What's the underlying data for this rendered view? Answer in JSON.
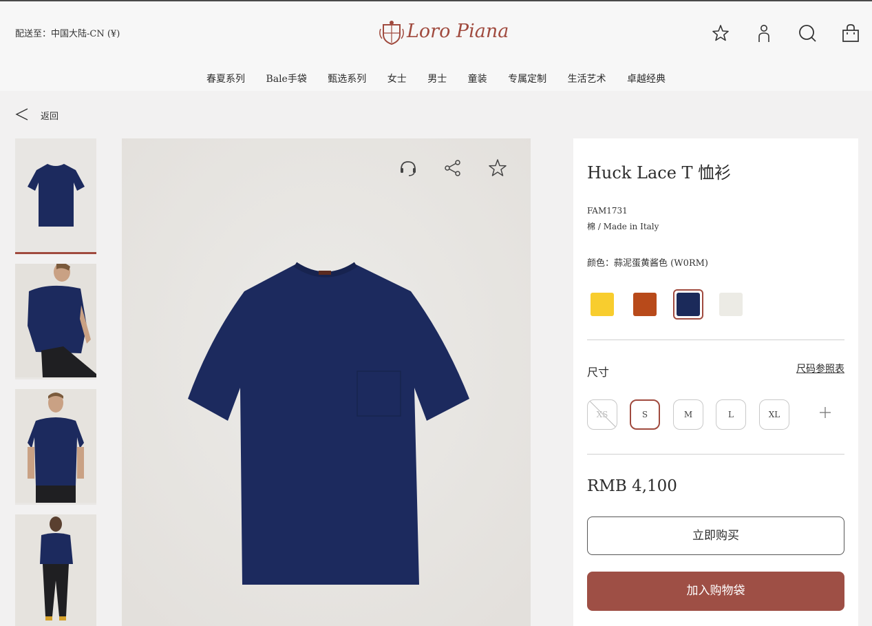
{
  "header": {
    "ship_to": "配送至：中国大陆-CN (¥)",
    "logo_text": "Loro Piana",
    "icons": [
      "star-icon",
      "user-icon",
      "search-icon",
      "bag-icon"
    ]
  },
  "nav": {
    "items": [
      "春夏系列",
      "Bale手袋",
      "甄选系列",
      "女士",
      "男士",
      "童装",
      "专属定制",
      "生活艺术",
      "卓越经典"
    ]
  },
  "back": {
    "label": "返回"
  },
  "product": {
    "title": "Huck Lace T 恤衫",
    "sku": "FAM1731",
    "material": "棉 / Made in Italy",
    "color_label": "颜色：蒜泥蛋黄酱色 (W0RM)",
    "colors": [
      {
        "name": "yellow",
        "hex": "#f8cd2e"
      },
      {
        "name": "rust",
        "hex": "#b84a1a"
      },
      {
        "name": "navy",
        "hex": "#1b2a5a",
        "selected": true
      },
      {
        "name": "off-white",
        "hex": "#ecebe5"
      }
    ],
    "size_label": "尺寸",
    "size_guide": "尺码参照表",
    "sizes": [
      {
        "label": "XS",
        "available": false
      },
      {
        "label": "S",
        "selected": true
      },
      {
        "label": "M"
      },
      {
        "label": "L"
      },
      {
        "label": "XL"
      }
    ],
    "price": "RMB 4,100",
    "buy_now": "立即购买",
    "add_to_bag": "加入购物袋"
  },
  "colors": {
    "accent": "#a04a3e",
    "shirt": "#1c2a5e",
    "cart_button": "#9e4f45"
  }
}
